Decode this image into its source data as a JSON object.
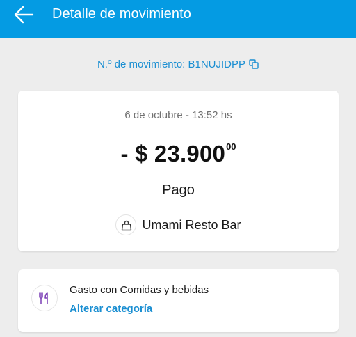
{
  "header": {
    "back_icon": "arrow-left-icon",
    "title": "Detalle de movimiento",
    "background_color": "#049be3"
  },
  "movement": {
    "id_label": "N.º de movimiento: B1NUJIDPP",
    "copy_icon": "copy-icon"
  },
  "detail": {
    "date": "6 de octubre - 13:52 hs",
    "amount_main": "- $ 23.900",
    "amount_cents": "00",
    "type": "Pago",
    "merchant_icon": "shopping-bag-icon",
    "merchant_name": "Umami Resto Bar"
  },
  "category": {
    "icon": "fork-knife-icon",
    "icon_color": "#7b3fb5",
    "title": "Gasto con Comidas y bebidas",
    "change_link": "Alterar categoría",
    "link_color": "#1b8fd2"
  }
}
